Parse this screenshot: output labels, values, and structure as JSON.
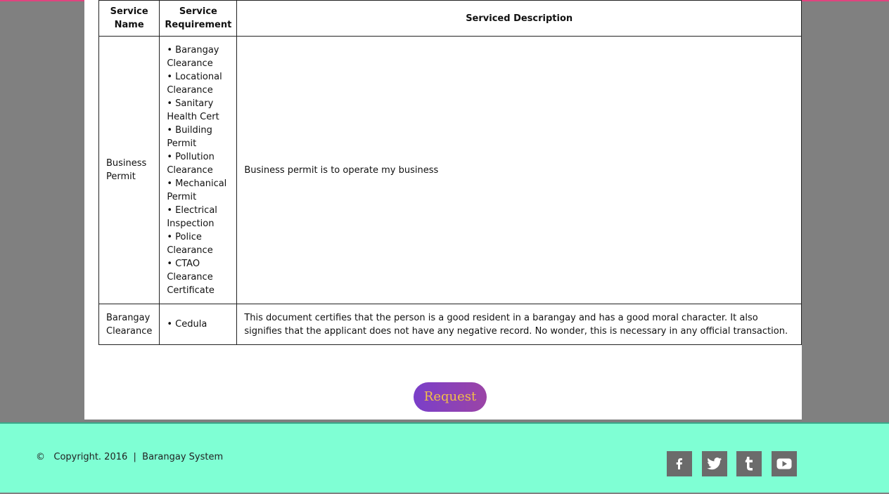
{
  "table": {
    "headers": {
      "name": "Service Name",
      "requirement": "Service Requirement",
      "description": "Serviced Description"
    },
    "rows": [
      {
        "name": "Business Permit",
        "requirements": [
          "• Barangay Clearance",
          "• Locational Clearance",
          "• Sanitary Health Cert",
          "• Building Permit",
          "• Pollution Clearance",
          "• Mechanical Permit",
          "• Electrical Inspection",
          "• Police Clearance",
          "• CTAO Clearance Certificate"
        ],
        "description": "Business permit is to operate my business"
      },
      {
        "name": "Barangay Clearance",
        "requirements": [
          "• Cedula"
        ],
        "description": "This document certifies that the person is a good resident in a barangay and has a good moral character. It also signifies that the applicant does not have any negative record. No wonder, this is necessary in any official transaction."
      }
    ]
  },
  "request_button": {
    "label": "Request"
  },
  "footer": {
    "copyright": "©   Copyright. 2016  |  Barangay System",
    "social": [
      "facebook-icon",
      "twitter-icon",
      "tumblr-icon",
      "youtube-icon"
    ]
  },
  "colors": {
    "backdrop": "#808080",
    "footer_bg": "#7fffd4",
    "button_gradient_start": "#7a3fc9",
    "button_gradient_end": "#9b44a6",
    "button_text": "#f2bf48",
    "social_bg": "#6b6b6b"
  }
}
